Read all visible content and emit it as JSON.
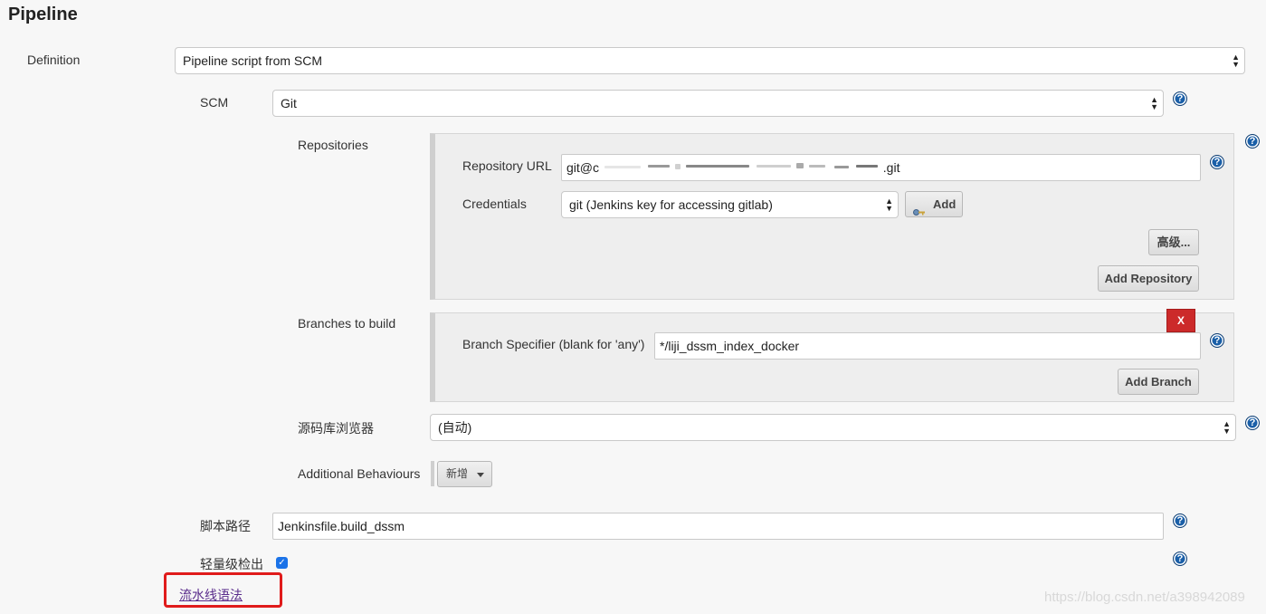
{
  "section_title": "Pipeline",
  "definition": {
    "label": "Definition",
    "selected": "Pipeline script from SCM"
  },
  "scm": {
    "label": "SCM",
    "selected": "Git"
  },
  "repositories": {
    "label": "Repositories",
    "url_label": "Repository URL",
    "url_value_prefix": "git@c",
    "url_value_suffix": ".git",
    "credentials_label": "Credentials",
    "credentials_selected": "git (Jenkins key for accessing gitlab)",
    "add_label": "Add",
    "advanced_label": "高级...",
    "add_repository_label": "Add Repository"
  },
  "branches": {
    "label": "Branches to build",
    "delete_label": "X",
    "specifier_label": "Branch Specifier (blank for 'any')",
    "specifier_value": "*/liji_dssm_index_docker",
    "add_branch_label": "Add Branch"
  },
  "browser": {
    "label": "源码库浏览器",
    "selected": "(自动)"
  },
  "behaviours": {
    "label": "Additional Behaviours",
    "add_label": "新增"
  },
  "script_path": {
    "label": "脚本路径",
    "value": "Jenkinsfile.build_dssm"
  },
  "lightweight": {
    "label": "轻量级检出",
    "checked": true
  },
  "pipeline_syntax_link": "流水线语法",
  "help_glyph": "?",
  "watermark": "https://blog.csdn.net/a398942089",
  "colors": {
    "help_icon": "#1a5fa8",
    "delete_button": "#cc2a2a",
    "highlight_box": "#e01b1b",
    "link": "#5a2d8c"
  }
}
